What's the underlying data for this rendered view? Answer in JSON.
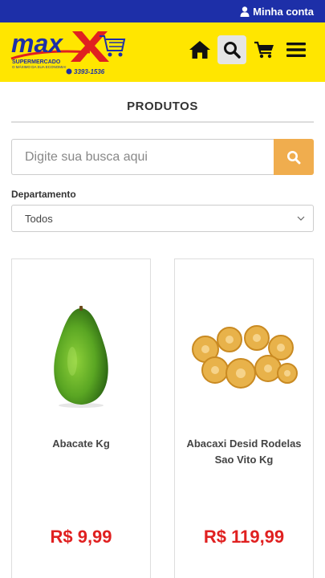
{
  "topbar": {
    "account_label": "Minha conta"
  },
  "header": {
    "logo_text": "max",
    "logo_sub": "SUPERMERCADO",
    "logo_tagline": "O MÁXIMO DA SUA ECONOMIA!",
    "logo_phone": "3393-1536",
    "brand_blue": "#1d2fa8",
    "brand_yellow": "#ffe600",
    "brand_red": "#e02020"
  },
  "page": {
    "title": "PRODUTOS"
  },
  "search": {
    "placeholder": "Digite sua busca aqui",
    "button_color": "#f0ad4e"
  },
  "filter": {
    "label": "Departamento",
    "selected": "Todos"
  },
  "products": [
    {
      "name": "Abacate Kg",
      "price": "R$ 9,99",
      "image": "avocado"
    },
    {
      "name": "Abacaxi Desid Rodelas Sao Vito Kg",
      "price": "R$ 119,99",
      "image": "dried-pineapple-rings"
    }
  ]
}
